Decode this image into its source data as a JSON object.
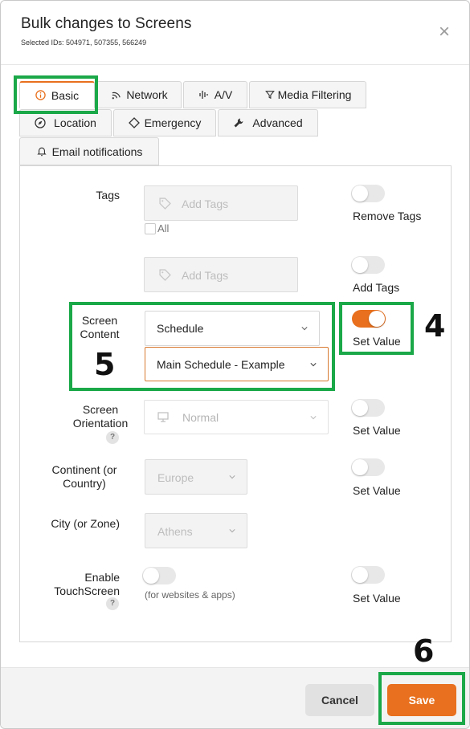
{
  "modal": {
    "title": "Bulk changes to Screens",
    "subtitle": "Selected IDs: 504971, 507355, 566249",
    "close_glyph": "×"
  },
  "tabs": [
    {
      "label": "Basic",
      "icon": "info-icon",
      "active": true
    },
    {
      "label": "Network",
      "icon": "wifi-icon"
    },
    {
      "label": "A/V",
      "icon": "audio-wave-icon"
    },
    {
      "label": "Media Filtering",
      "icon": "filter-icon"
    },
    {
      "label": "Location",
      "icon": "compass-icon"
    },
    {
      "label": "Emergency",
      "icon": "diamond-alert-icon"
    },
    {
      "label": "Advanced",
      "icon": "wrench-icon"
    },
    {
      "label": "Email notifications",
      "icon": "bell-icon"
    }
  ],
  "form": {
    "tags": {
      "label": "Tags",
      "remove_placeholder": "Add Tags",
      "all_label": "All",
      "remove_toggle_label": "Remove Tags",
      "add_placeholder": "Add Tags",
      "add_toggle_label": "Add Tags"
    },
    "screen_content": {
      "label_line1": "Screen",
      "label_line2": "Content",
      "type_value": "Schedule",
      "schedule_value": "Main Schedule - Example",
      "toggle_label": "Set Value",
      "toggle_on": true
    },
    "screen_orientation": {
      "label_line1": "Screen",
      "label_line2": "Orientation",
      "help": "?",
      "value": "Normal",
      "toggle_label": "Set Value"
    },
    "continent": {
      "label_line1": "Continent (or",
      "label_line2": "Country)",
      "value": "Europe",
      "toggle_label": "Set Value"
    },
    "city": {
      "label": "City (or Zone)",
      "value": "Athens",
      "toggle_label": "Set Value"
    },
    "touchscreen": {
      "label_line1": "Enable",
      "label_line2": "TouchScreen",
      "help": "?",
      "note": "(for websites & apps)",
      "toggle_label": "Set Value"
    }
  },
  "footer": {
    "cancel_label": "Cancel",
    "save_label": "Save"
  },
  "annotations": {
    "step4": "4",
    "step5": "5",
    "step6": "6"
  },
  "colors": {
    "accent": "#e8701e",
    "annotation_green": "#1aa848"
  }
}
